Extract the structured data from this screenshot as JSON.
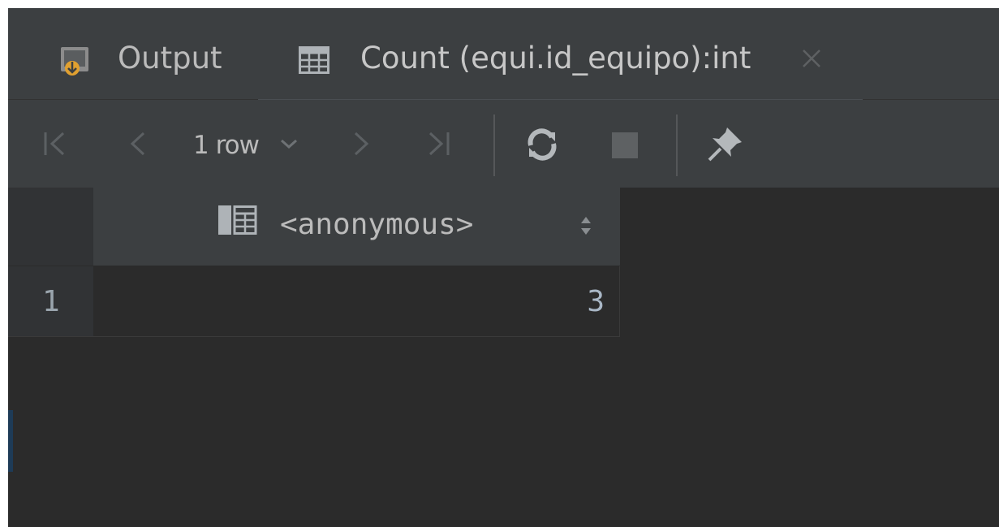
{
  "tabs": [
    {
      "label": "Output",
      "icon": "output-console-icon"
    },
    {
      "label": "Count (equi.id_equipo):int",
      "icon": "table-grid-icon",
      "active": true
    }
  ],
  "toolbar": {
    "rows_label": "1 row",
    "icons": [
      "first-page-icon",
      "previous-page-icon",
      "chevron-down-icon",
      "next-page-icon",
      "last-page-icon",
      "refresh-icon",
      "stop-icon",
      "pin-icon"
    ]
  },
  "grid": {
    "columns": [
      {
        "name": "<anonymous>"
      }
    ],
    "rows": [
      {
        "number": "1",
        "values": [
          "3"
        ]
      }
    ]
  },
  "colors": {
    "background": "#2b2b2b",
    "toolbar": "#3c3f41",
    "text": "#bbbbbb",
    "value": "#a9b7c6"
  }
}
